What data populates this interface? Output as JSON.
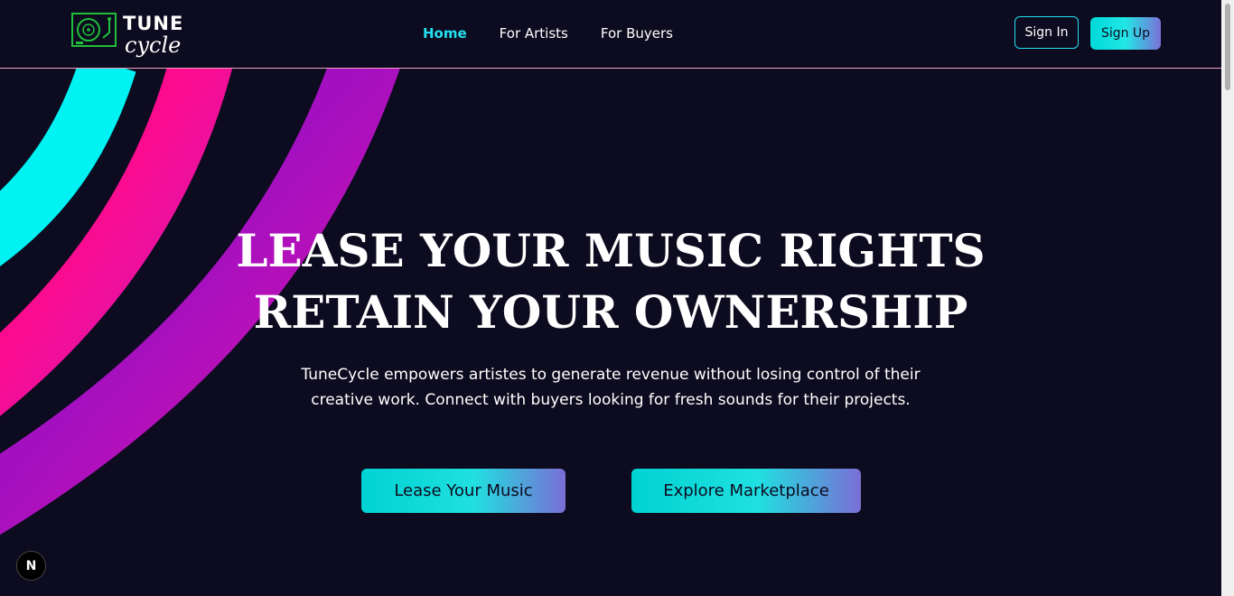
{
  "brand": {
    "name_top": "TUNE",
    "name_bottom": "cycle",
    "logo_icon": "turntable-icon",
    "logo_color": "#1fbf3a"
  },
  "nav": {
    "items": [
      {
        "label": "Home",
        "active": true
      },
      {
        "label": "For Artists",
        "active": false
      },
      {
        "label": "For Buyers",
        "active": false
      }
    ]
  },
  "auth": {
    "sign_in": "Sign In",
    "sign_up": "Sign Up"
  },
  "hero": {
    "title_line1": "LEASE YOUR MUSIC RIGHTS",
    "title_line2": "RETAIN YOUR OWNERSHIP",
    "subtitle": "TuneCycle empowers artistes to generate revenue without losing control of their creative work. Connect with buyers looking for fresh sounds for their projects.",
    "cta_primary": "Lease Your Music",
    "cta_secondary": "Explore Marketplace"
  },
  "badge": {
    "label": "N",
    "icon": "nextjs-icon"
  },
  "colors": {
    "background": "#0d0b1f",
    "accent_cyan": "#22e0f0",
    "accent_pink": "#ff0f8f",
    "accent_purple": "#8a10c8",
    "header_border": "#f0a0c0"
  }
}
